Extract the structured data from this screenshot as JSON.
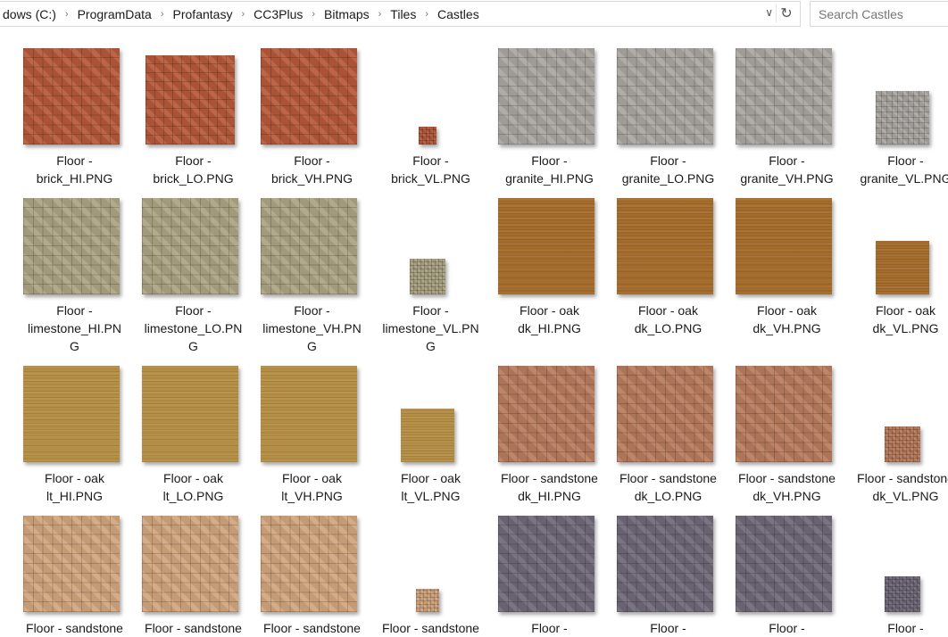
{
  "address_bar": {
    "crumbs": [
      "dows (C:)",
      "ProgramData",
      "Profantasy",
      "CC3Plus",
      "Bitmaps",
      "Tiles",
      "Castles"
    ],
    "separator_icon": "chevron-right-icon",
    "dropdown_icon": "chevron-down-icon",
    "refresh_icon": "refresh-icon"
  },
  "search": {
    "placeholder": "Search Castles"
  },
  "textures": {
    "brick": {
      "color": "#b5583a",
      "pattern": "stone"
    },
    "granite": {
      "color": "#a9a6a1",
      "pattern": "stone"
    },
    "limestone": {
      "color": "#aba383",
      "pattern": "stone"
    },
    "oakdk": {
      "color": "#a56c2c",
      "pattern": "wood"
    },
    "oaklt": {
      "color": "#b58f45",
      "pattern": "wood"
    },
    "sanddk": {
      "color": "#b97b5d",
      "pattern": "stone"
    },
    "sandlt": {
      "color": "#d1a57d",
      "pattern": "stone"
    },
    "slate": {
      "color": "#6f6878",
      "pattern": "stone"
    }
  },
  "files": [
    {
      "lines": [
        "Floor -",
        "brick_HI.PNG"
      ],
      "texture": "brick"
    },
    {
      "lines": [
        "Floor -",
        "brick_LO.PNG"
      ],
      "texture": "brick"
    },
    {
      "lines": [
        "Floor -",
        "brick_VH.PNG"
      ],
      "texture": "brick"
    },
    {
      "lines": [
        "Floor -",
        "brick_VL.PNG"
      ],
      "texture": "brick"
    },
    {
      "lines": [
        "Floor -",
        "granite_HI.PNG"
      ],
      "texture": "granite"
    },
    {
      "lines": [
        "Floor -",
        "granite_LO.PNG"
      ],
      "texture": "granite"
    },
    {
      "lines": [
        "Floor -",
        "granite_VH.PNG"
      ],
      "texture": "granite"
    },
    {
      "lines": [
        "Floor -",
        "granite_VL.PNG"
      ],
      "texture": "granite"
    },
    {
      "lines": [
        "Floor -",
        "limestone_HI.PN",
        "G"
      ],
      "texture": "limestone"
    },
    {
      "lines": [
        "Floor -",
        "limestone_LO.PN",
        "G"
      ],
      "texture": "limestone"
    },
    {
      "lines": [
        "Floor -",
        "limestone_VH.PN",
        "G"
      ],
      "texture": "limestone"
    },
    {
      "lines": [
        "Floor -",
        "limestone_VL.PN",
        "G"
      ],
      "texture": "limestone"
    },
    {
      "lines": [
        "Floor - oak",
        "dk_HI.PNG"
      ],
      "texture": "oakdk"
    },
    {
      "lines": [
        "Floor - oak",
        "dk_LO.PNG"
      ],
      "texture": "oakdk"
    },
    {
      "lines": [
        "Floor - oak",
        "dk_VH.PNG"
      ],
      "texture": "oakdk"
    },
    {
      "lines": [
        "Floor - oak",
        "dk_VL.PNG"
      ],
      "texture": "oakdk"
    },
    {
      "lines": [
        "Floor - oak",
        "lt_HI.PNG"
      ],
      "texture": "oaklt"
    },
    {
      "lines": [
        "Floor - oak",
        "lt_LO.PNG"
      ],
      "texture": "oaklt"
    },
    {
      "lines": [
        "Floor - oak",
        "lt_VH.PNG"
      ],
      "texture": "oaklt"
    },
    {
      "lines": [
        "Floor - oak",
        "lt_VL.PNG"
      ],
      "texture": "oaklt"
    },
    {
      "lines": [
        "Floor - sandstone",
        "dk_HI.PNG"
      ],
      "texture": "sanddk"
    },
    {
      "lines": [
        "Floor - sandstone",
        "dk_LO.PNG"
      ],
      "texture": "sanddk"
    },
    {
      "lines": [
        "Floor - sandstone",
        "dk_VH.PNG"
      ],
      "texture": "sanddk"
    },
    {
      "lines": [
        "Floor - sandstone",
        "dk_VL.PNG"
      ],
      "texture": "sanddk"
    },
    {
      "lines": [
        "Floor - sandstone"
      ],
      "texture": "sandlt"
    },
    {
      "lines": [
        "Floor - sandstone"
      ],
      "texture": "sandlt"
    },
    {
      "lines": [
        "Floor - sandstone"
      ],
      "texture": "sandlt"
    },
    {
      "lines": [
        "Floor - sandstone"
      ],
      "texture": "sandlt"
    },
    {
      "lines": [
        "Floor -"
      ],
      "texture": "slate"
    },
    {
      "lines": [
        "Floor -"
      ],
      "texture": "slate"
    },
    {
      "lines": [
        "Floor -"
      ],
      "texture": "slate"
    },
    {
      "lines": [
        "Floor -"
      ],
      "texture": "slate"
    }
  ]
}
